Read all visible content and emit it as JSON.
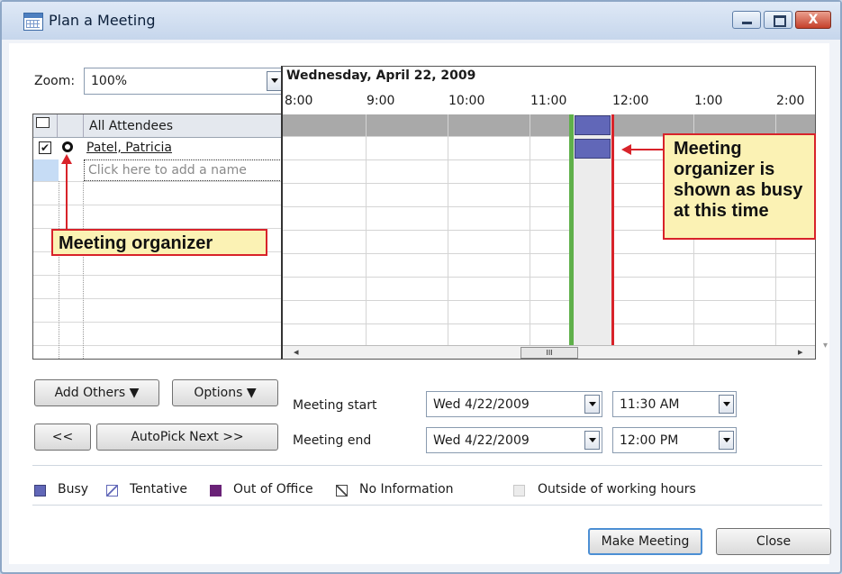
{
  "window": {
    "title": "Plan a Meeting",
    "close_glyph": "X"
  },
  "zoom": {
    "label": "Zoom:",
    "value": "100%"
  },
  "attendees": {
    "header": "All Attendees",
    "organizer": "Patel, Patricia",
    "add_placeholder": "Click here to add a name"
  },
  "schedule": {
    "date": "Wednesday, April 22, 2009",
    "hours": [
      "8:00",
      "9:00",
      "10:00",
      "11:00",
      "12:00",
      "1:00",
      "2:00"
    ],
    "busy_start": 11.5,
    "busy_end": 12.0,
    "scroll_thumb": "III"
  },
  "buttons": {
    "add_others": "Add Others",
    "options": "Options",
    "prev": "<<",
    "autopick": "AutoPick Next >>",
    "make_meeting": "Make Meeting",
    "close": "Close"
  },
  "meeting": {
    "start_label": "Meeting start",
    "end_label": "Meeting end",
    "start_date": "Wed 4/22/2009",
    "start_time": "11:30 AM",
    "end_date": "Wed 4/22/2009",
    "end_time": "12:00 PM"
  },
  "legend": {
    "busy": "Busy",
    "tentative": "Tentative",
    "out_of_office": "Out of Office",
    "no_information": "No Information",
    "outside_hours": "Outside of working hours"
  },
  "callouts": {
    "organizer": "Meeting organizer",
    "busy_lines": [
      "Meeting",
      "organizer is",
      "shown as busy",
      "at this time"
    ]
  },
  "colors": {
    "busy": "#6167b8",
    "out_of_office": "#6a2277",
    "start_line": "#5fb04a",
    "end_line": "#d8232a",
    "callout_bg": "#fbf2b4",
    "callout_border": "#d8232a"
  }
}
